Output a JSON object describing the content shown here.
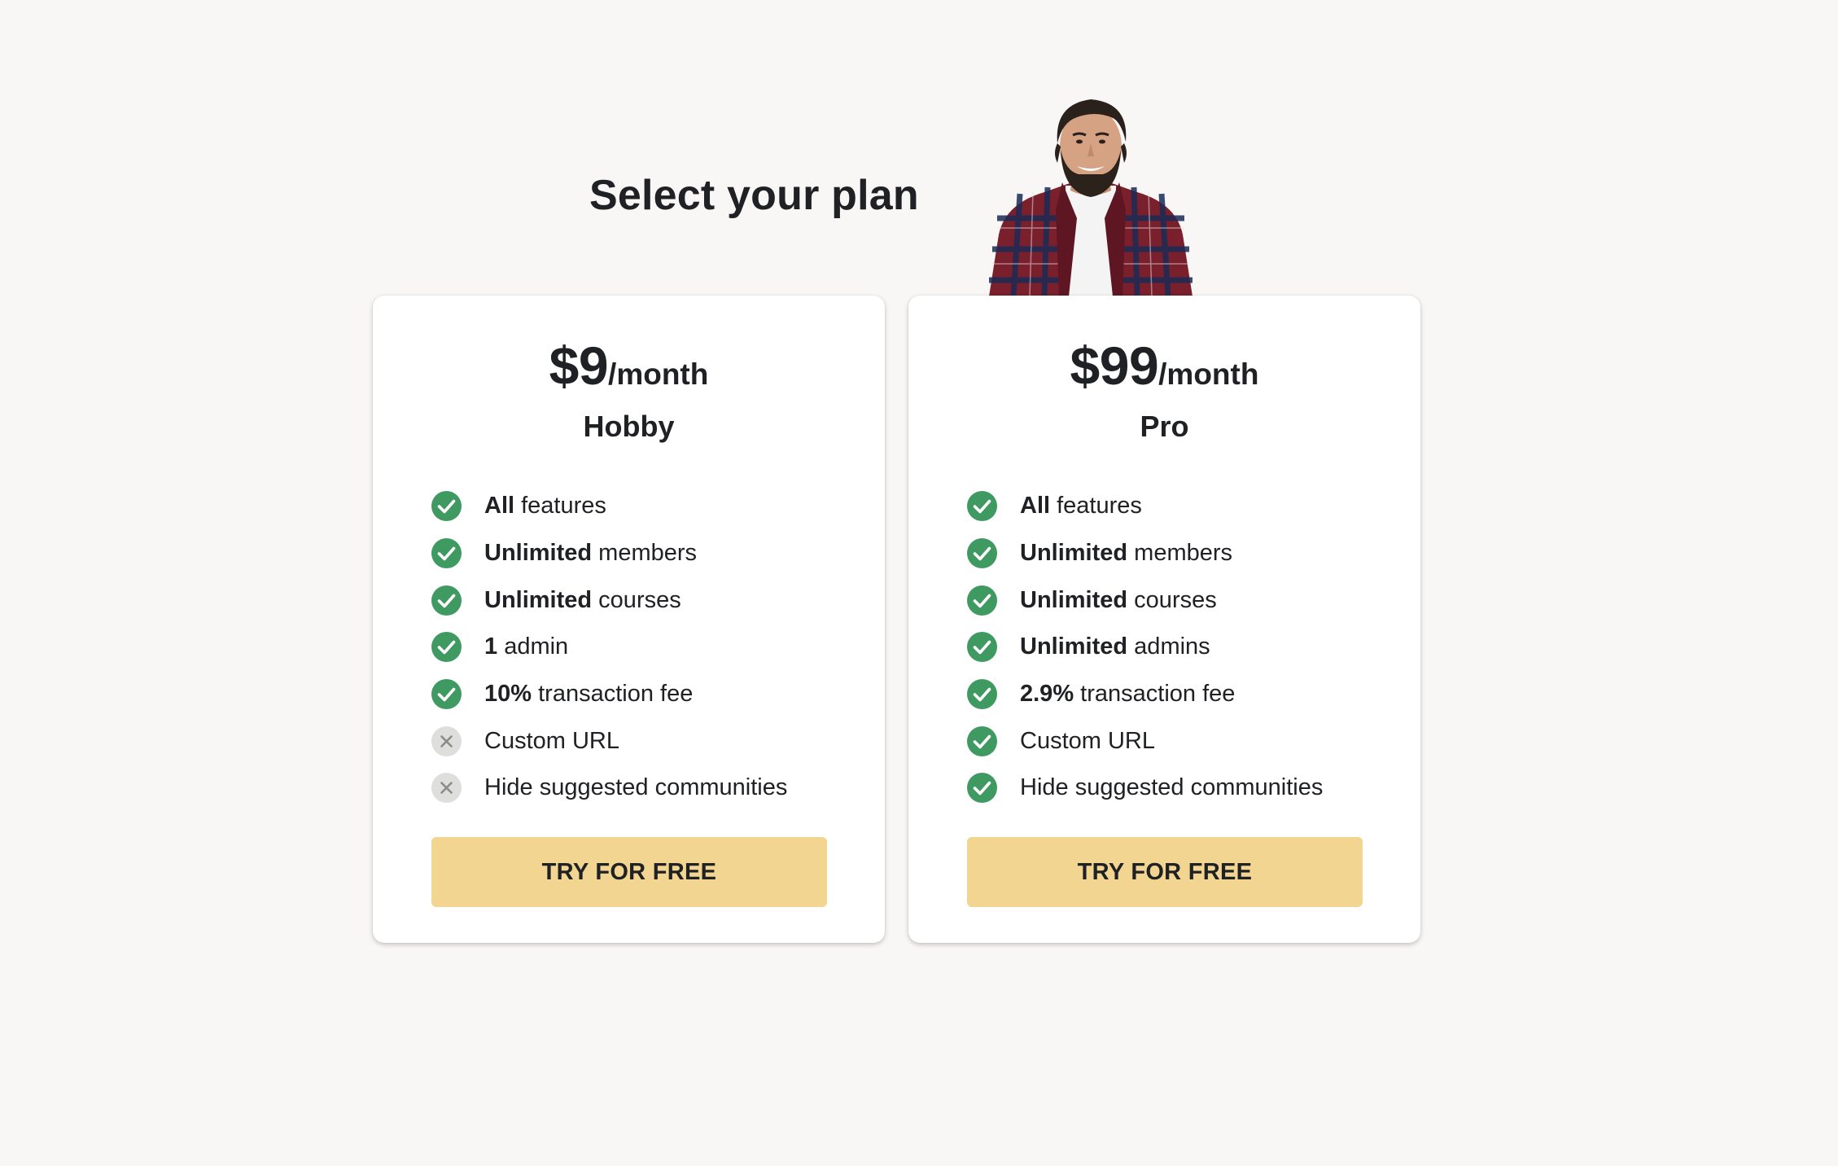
{
  "page": {
    "title": "Select your plan"
  },
  "colors": {
    "background": "#f8f7f5",
    "check": "#3f9a62",
    "cross_bg": "#dededc",
    "cross": "#8a8a8a",
    "button": "#f1d591",
    "text": "#202124"
  },
  "mascot": {
    "icon": "person-plaid-shirt-illustration"
  },
  "plans": [
    {
      "price": "$9",
      "period": "/month",
      "name": "Hobby",
      "button_label": "TRY FOR FREE",
      "features": [
        {
          "strong": "All",
          "text": " features",
          "included": true,
          "icon": "check-circle-icon"
        },
        {
          "strong": "Unlimited",
          "text": " members",
          "included": true,
          "icon": "check-circle-icon"
        },
        {
          "strong": "Unlimited",
          "text": " courses",
          "included": true,
          "icon": "check-circle-icon"
        },
        {
          "strong": "1",
          "text": " admin",
          "included": true,
          "icon": "check-circle-icon"
        },
        {
          "strong": "10%",
          "text": " transaction fee",
          "included": true,
          "icon": "check-circle-icon"
        },
        {
          "strong": "",
          "text": "Custom URL",
          "included": false,
          "icon": "x-circle-icon"
        },
        {
          "strong": "",
          "text": "Hide suggested communities",
          "included": false,
          "icon": "x-circle-icon"
        }
      ]
    },
    {
      "price": "$99",
      "period": "/month",
      "name": "Pro",
      "button_label": "TRY FOR FREE",
      "features": [
        {
          "strong": "All",
          "text": " features",
          "included": true,
          "icon": "check-circle-icon"
        },
        {
          "strong": "Unlimited",
          "text": " members",
          "included": true,
          "icon": "check-circle-icon"
        },
        {
          "strong": "Unlimited",
          "text": " courses",
          "included": true,
          "icon": "check-circle-icon"
        },
        {
          "strong": "Unlimited",
          "text": " admins",
          "included": true,
          "icon": "check-circle-icon"
        },
        {
          "strong": "2.9%",
          "text": " transaction fee",
          "included": true,
          "icon": "check-circle-icon"
        },
        {
          "strong": "",
          "text": "Custom URL",
          "included": true,
          "icon": "check-circle-icon"
        },
        {
          "strong": "",
          "text": "Hide suggested communities",
          "included": true,
          "icon": "check-circle-icon"
        }
      ]
    }
  ]
}
